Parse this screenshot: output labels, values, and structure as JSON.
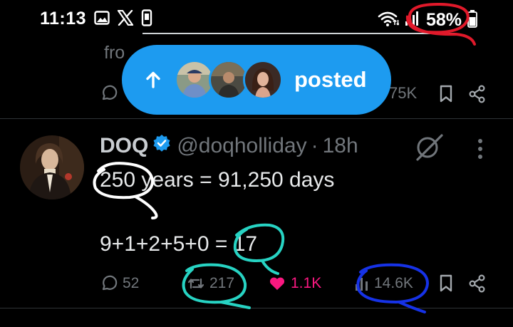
{
  "status_bar": {
    "time": "11:13",
    "left_icons": [
      "image-icon",
      "x-logo-icon",
      "phone-icon"
    ],
    "right_icons": [
      "wifi-icon",
      "signal-icon",
      "battery-icon"
    ],
    "battery_percent": "58%"
  },
  "previous_tweet": {
    "text_snippet": "fro",
    "views_fragment": "75K",
    "icons": [
      "reply-icon",
      "bookmark-icon",
      "share-icon"
    ]
  },
  "new_posts_pill": {
    "label": "posted",
    "avatar_count": 3,
    "icon": "arrow-up-icon",
    "color": "#1d9bf0"
  },
  "tweet": {
    "display_name": "DOQ",
    "verified": true,
    "handle": "@doqholliday",
    "separator": "·",
    "time_ago": "18h",
    "line1": "250 years = 91,250 days",
    "line2": "9+1+2+5+0 = 17",
    "actions": {
      "replies": "52",
      "reposts": "217",
      "likes": "1.1K",
      "views": "14.6K"
    },
    "like_color": "#f91880",
    "muted_color": "#71767b"
  },
  "annotations": {
    "red_ring_on": "58%",
    "white_ring_on": "250",
    "teal_rings_on": [
      "17",
      "217"
    ],
    "blue_ring_on": "14.6K",
    "colors": {
      "red": "#e0192a",
      "white": "#ffffff",
      "teal": "#27d3c3",
      "blue": "#1632e6"
    }
  }
}
